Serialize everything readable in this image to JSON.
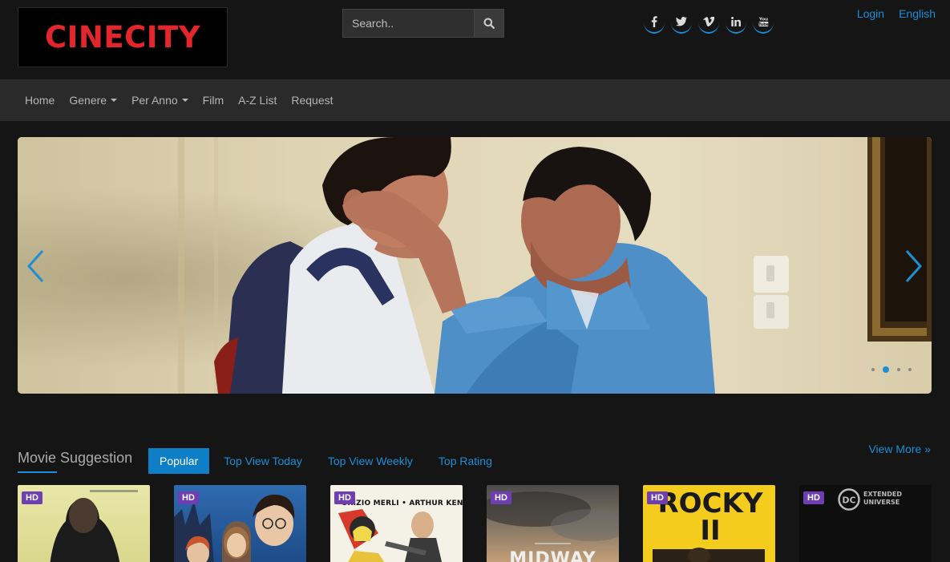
{
  "header": {
    "logo_text": "CINECITY",
    "search_placeholder": "Search..",
    "social": [
      "f",
      "t",
      "v",
      "in",
      "yt"
    ],
    "top_links": {
      "login": "Login",
      "language": "English"
    }
  },
  "nav": {
    "items": [
      {
        "label": "Home",
        "dropdown": false
      },
      {
        "label": "Genere",
        "dropdown": true
      },
      {
        "label": "Per Anno",
        "dropdown": true
      },
      {
        "label": "Film",
        "dropdown": false
      },
      {
        "label": "A-Z List",
        "dropdown": false
      },
      {
        "label": "Request",
        "dropdown": false
      }
    ]
  },
  "slider": {
    "active_index": 1,
    "dot_count": 4
  },
  "suggestion": {
    "title": "Movie Suggestion",
    "tabs": [
      "Popular",
      "Top View Today",
      "Top View Weekly",
      "Top Rating"
    ],
    "active_tab": "Popular",
    "view_more": "View More »",
    "posters": [
      {
        "badge": "HD",
        "caption": ""
      },
      {
        "badge": "HD",
        "caption": ""
      },
      {
        "badge": "HD",
        "caption": "URIZIO MERLI • ARTHUR KENNEDY"
      },
      {
        "badge": "HD",
        "caption": "MIDWAY"
      },
      {
        "badge": "HD",
        "caption": "ROCKY II"
      },
      {
        "badge": "HD",
        "caption": "EXTENDED UNIVERSE"
      }
    ]
  },
  "colors": {
    "accent": "#1c8fd6",
    "logo_red": "#e3262c",
    "badge_purple": "#6f3fb2",
    "nav_bg": "#2a2a2a",
    "page_bg": "#151515"
  }
}
